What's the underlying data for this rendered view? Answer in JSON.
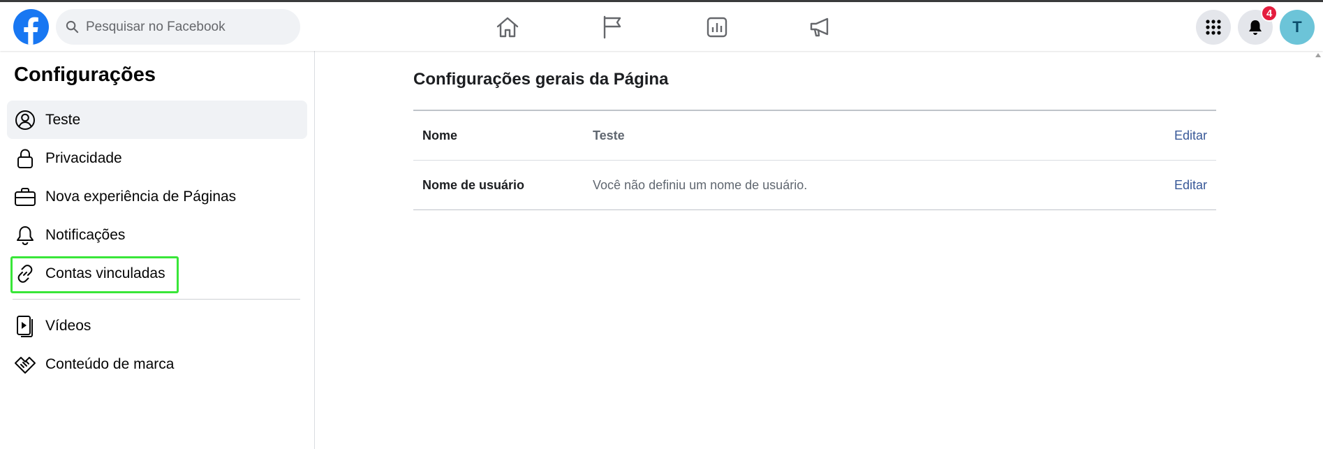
{
  "header": {
    "search_placeholder": "Pesquisar no Facebook",
    "notification_count": "4",
    "avatar_initial": "T"
  },
  "sidebar": {
    "title": "Configurações",
    "items": [
      {
        "label": "Teste",
        "icon": "profile-icon"
      },
      {
        "label": "Privacidade",
        "icon": "lock-icon"
      },
      {
        "label": "Nova experiência de Páginas",
        "icon": "briefcase-icon"
      },
      {
        "label": "Notificações",
        "icon": "bell-icon"
      },
      {
        "label": "Contas vinculadas",
        "icon": "link-icon"
      },
      {
        "label": "Vídeos",
        "icon": "video-icon"
      },
      {
        "label": "Conteúdo de marca",
        "icon": "handshake-icon"
      }
    ]
  },
  "main": {
    "title": "Configurações gerais da Página",
    "rows": [
      {
        "key": "Nome",
        "value": "Teste",
        "action": "Editar"
      },
      {
        "key": "Nome de usuário",
        "value": "Você não definiu um nome de usuário.",
        "action": "Editar"
      }
    ]
  },
  "colors": {
    "brand": "#1877f2",
    "link": "#385898",
    "highlight": "#39e639",
    "badge": "#e41e3f"
  }
}
